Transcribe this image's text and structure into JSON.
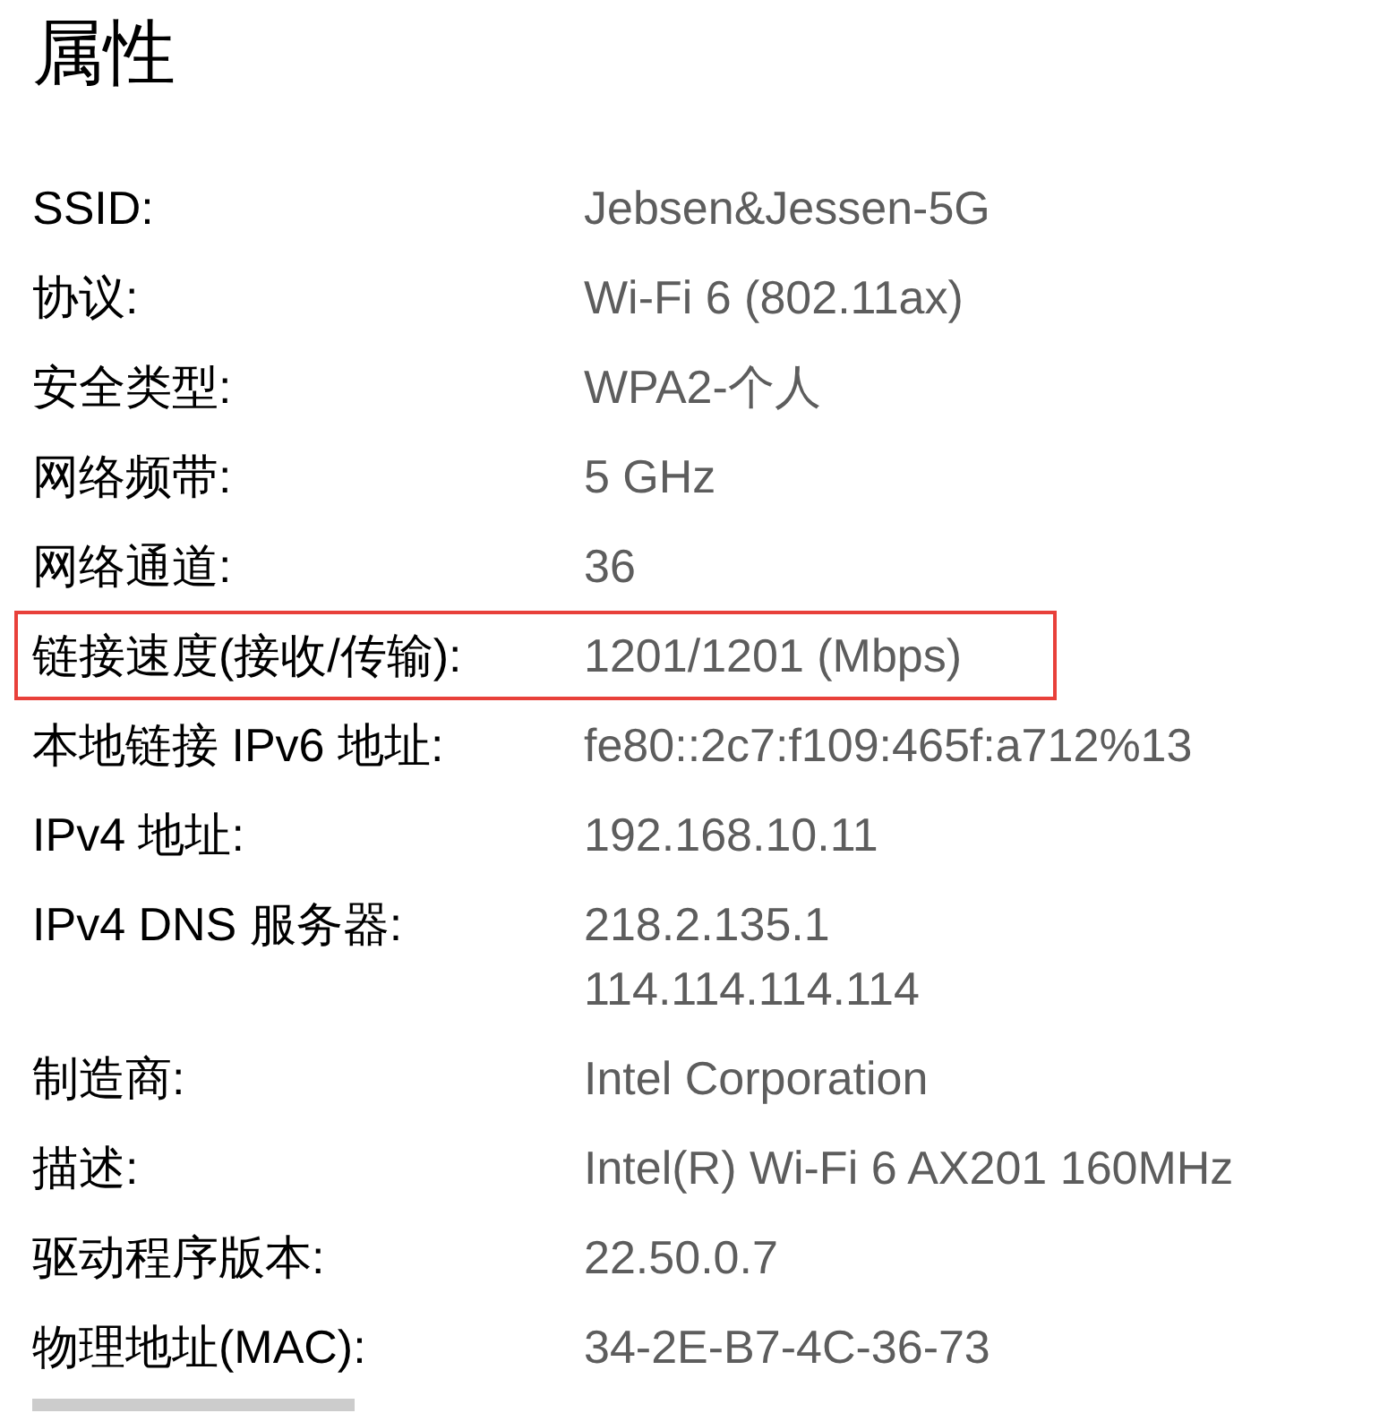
{
  "title": "属性",
  "properties": [
    {
      "label": "SSID:",
      "values": [
        "Jebsen&Jessen-5G"
      ],
      "highlighted": false
    },
    {
      "label": "协议:",
      "values": [
        "Wi-Fi 6 (802.11ax)"
      ],
      "highlighted": false
    },
    {
      "label": "安全类型:",
      "values": [
        "WPA2-个人"
      ],
      "highlighted": false
    },
    {
      "label": "网络频带:",
      "values": [
        "5 GHz"
      ],
      "highlighted": false
    },
    {
      "label": "网络通道:",
      "values": [
        "36"
      ],
      "highlighted": false
    },
    {
      "label": "链接速度(接收/传输):",
      "values": [
        "1201/1201 (Mbps)"
      ],
      "highlighted": true
    },
    {
      "label": "本地链接 IPv6 地址:",
      "values": [
        "fe80::2c7:f109:465f:a712%13"
      ],
      "highlighted": false
    },
    {
      "label": "IPv4 地址:",
      "values": [
        "192.168.10.11"
      ],
      "highlighted": false
    },
    {
      "label": "IPv4 DNS 服务器:",
      "values": [
        "218.2.135.1",
        "114.114.114.114"
      ],
      "highlighted": false
    },
    {
      "label": "制造商:",
      "values": [
        "Intel Corporation"
      ],
      "highlighted": false
    },
    {
      "label": "描述:",
      "values": [
        "Intel(R) Wi-Fi 6 AX201 160MHz"
      ],
      "highlighted": false
    },
    {
      "label": "驱动程序版本:",
      "values": [
        "22.50.0.7"
      ],
      "highlighted": false
    },
    {
      "label": "物理地址(MAC):",
      "values": [
        "34-2E-B7-4C-36-73"
      ],
      "highlighted": false
    }
  ]
}
